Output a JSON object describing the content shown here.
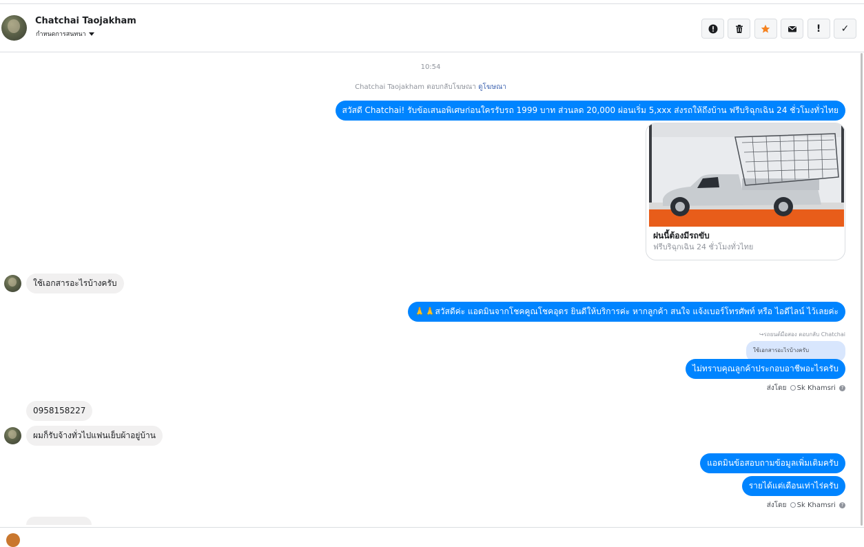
{
  "header": {
    "name": "Chatchai Taojakham",
    "subtitle": "กำหนดการสนทนา"
  },
  "toolbar": {
    "spam_icon": "!",
    "mark_icon": "!",
    "done_icon": "✓"
  },
  "chat": {
    "timestamp": "10:54",
    "reply_note_prefix": "Chatchai Taojakham ตอบกลับโฆษณา",
    "reply_note_link": "ดูโฆษณา",
    "messages": {
      "m1": "สวัสดี Chatchai! รับข้อเสนอพิเศษก่อนใครรับรถ 1999 บาท ส่วนลด 20,000  ผ่อนเริ่ม 5,xxx ส่งรถให้ถึงบ้าน ฟรีบริฉุกเฉิน 24 ชั่วโมงทั่วไทย",
      "m2": "ใช้เอกสารอะไรบ้างครับ",
      "m3": "🙏🙏สวัสดีค่ะ แอดมินจากโชคคูณโชคอุดร ยินดีให้บริการค่ะ หากลูกค้า สนใจ แจ้งเบอร์โทรศัพท์ หรือ ไอดีไลน์ ไว้เลยค่ะ",
      "m4": "ไม่ทราบคุณลูกค้าประกอบอาชีพอะไรครับ",
      "m5": "0958158227",
      "m6": "ผมก็รับจ้างทั่วไปแฟนเย็บผ้าอยู่บ้าน",
      "m7": "แอดมินข้อสอบถามข้อมูลเพิ่มเติมครับ",
      "m8": "รายได้แต่เดือนเท่าไร่ครับ"
    },
    "card": {
      "title": "ฝนนี้ต้องมีรถขับ",
      "subtitle": "ฟรีบริฉุกเฉิน 24 ชั่วโมงทั่วไทย"
    },
    "reply_context": "รถยนต์มือสอง ตอบกลับ Chatchai",
    "quoted_text": "ใช้เอกสารอะไรบ้างครับ",
    "sent_by_label": "ส่งโดย",
    "sent_by_name": "Sk Khamsri"
  },
  "colors": {
    "outgoing": "#0084ff",
    "incoming": "#f1f0f0",
    "accent_star": "#f5821f"
  }
}
